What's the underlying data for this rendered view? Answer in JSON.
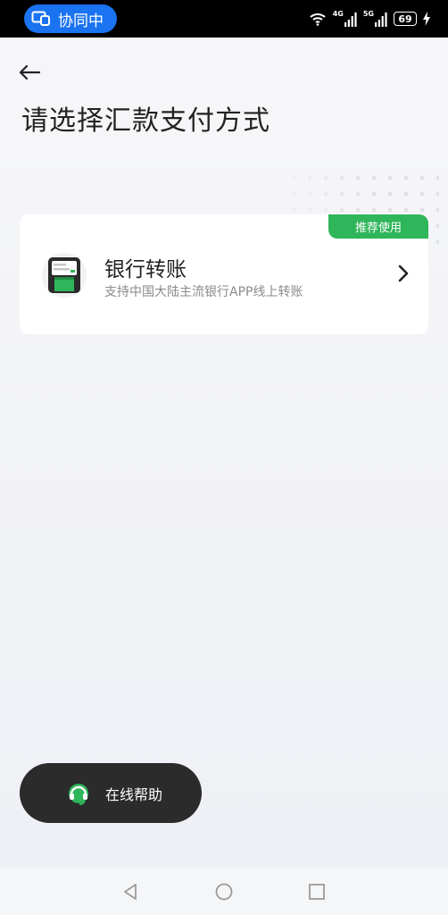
{
  "status_bar": {
    "collab_label": "协同中",
    "net1_tag": "4G",
    "net2_tag": "5G",
    "battery": "69"
  },
  "page": {
    "title": "请选择汇款支付方式"
  },
  "payment_option": {
    "badge": "推荐使用",
    "title": "银行转账",
    "subtitle": "支持中国大陆主流银行APP线上转账"
  },
  "help_button": {
    "label": "在线帮助"
  },
  "icons": [
    "screen-share-icon",
    "wifi-icon",
    "signal-icon",
    "battery-icon",
    "back-arrow-icon",
    "bank-card-icon",
    "chevron-right-icon",
    "headset-icon",
    "nav-back-icon",
    "nav-home-icon",
    "nav-recents-icon"
  ],
  "colors": {
    "accent_green": "#2fb55a",
    "collab_blue": "#1a73f0",
    "help_bg": "#2b2b2b"
  }
}
